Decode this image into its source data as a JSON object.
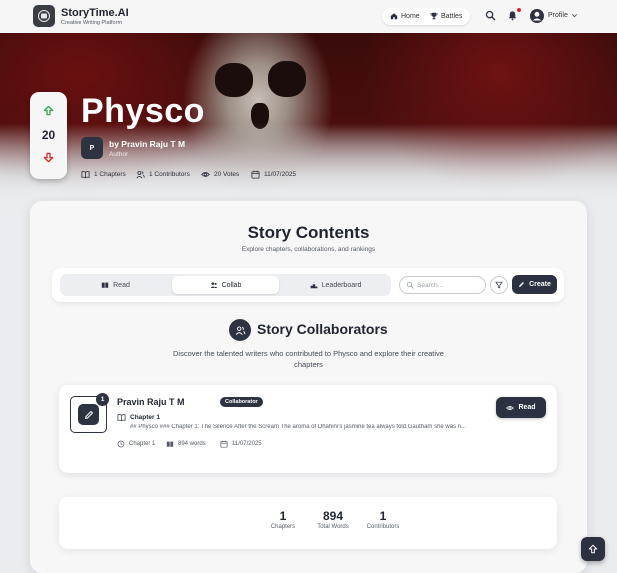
{
  "brand": {
    "name": "StoryTime.AI",
    "tagline": "Creative Writing Platform"
  },
  "nav": {
    "home_label": "Home",
    "battles_label": "Battles",
    "profile_label": "Profile"
  },
  "story": {
    "title": "Physco",
    "votes": "20",
    "author_initial": "P",
    "author_line": "by Pravin Raju T M",
    "author_role": "Author",
    "meta": {
      "chapters": "1 Chapters",
      "contributors": "1 Contributors",
      "votes": "20 Votes",
      "date": "11/07/2025"
    }
  },
  "contents": {
    "title": "Story Contents",
    "subtitle": "Explore chapters, collaborations, and rankings",
    "tabs": [
      {
        "label": "Read",
        "icon": "book-icon",
        "active": false
      },
      {
        "label": "Collab",
        "icon": "users-icon",
        "active": true
      },
      {
        "label": "Leaderboard",
        "icon": "podium-icon",
        "active": false
      }
    ],
    "search_placeholder": "Search...",
    "create_label": "Create"
  },
  "collaborators": {
    "title": "Story Collaborators",
    "description": "Discover the talented writers who contributed to Physco and explore their creative chapters",
    "items": [
      {
        "rank": "1",
        "name": "Pravin Raju T M",
        "role": "Collaborator",
        "chapter_title": "Chapter 1",
        "excerpt": "## Physco ### Chapter 1: The Silence After the Scream The aroma of Dhahini's jasmine tea always told Gautham she was n...",
        "chapter_label": "Chapter 1",
        "words": "894 words",
        "date": "11/07/2025",
        "read_label": "Read"
      }
    ]
  },
  "totals": [
    {
      "value": "1",
      "label": "Chapters"
    },
    {
      "value": "894",
      "label": "Total Words"
    },
    {
      "value": "1",
      "label": "Contributors"
    }
  ],
  "colors": {
    "primary": "#2b3140",
    "vote_up": "#2fa84f",
    "vote_down": "#e02424",
    "notification": "#e02424"
  }
}
